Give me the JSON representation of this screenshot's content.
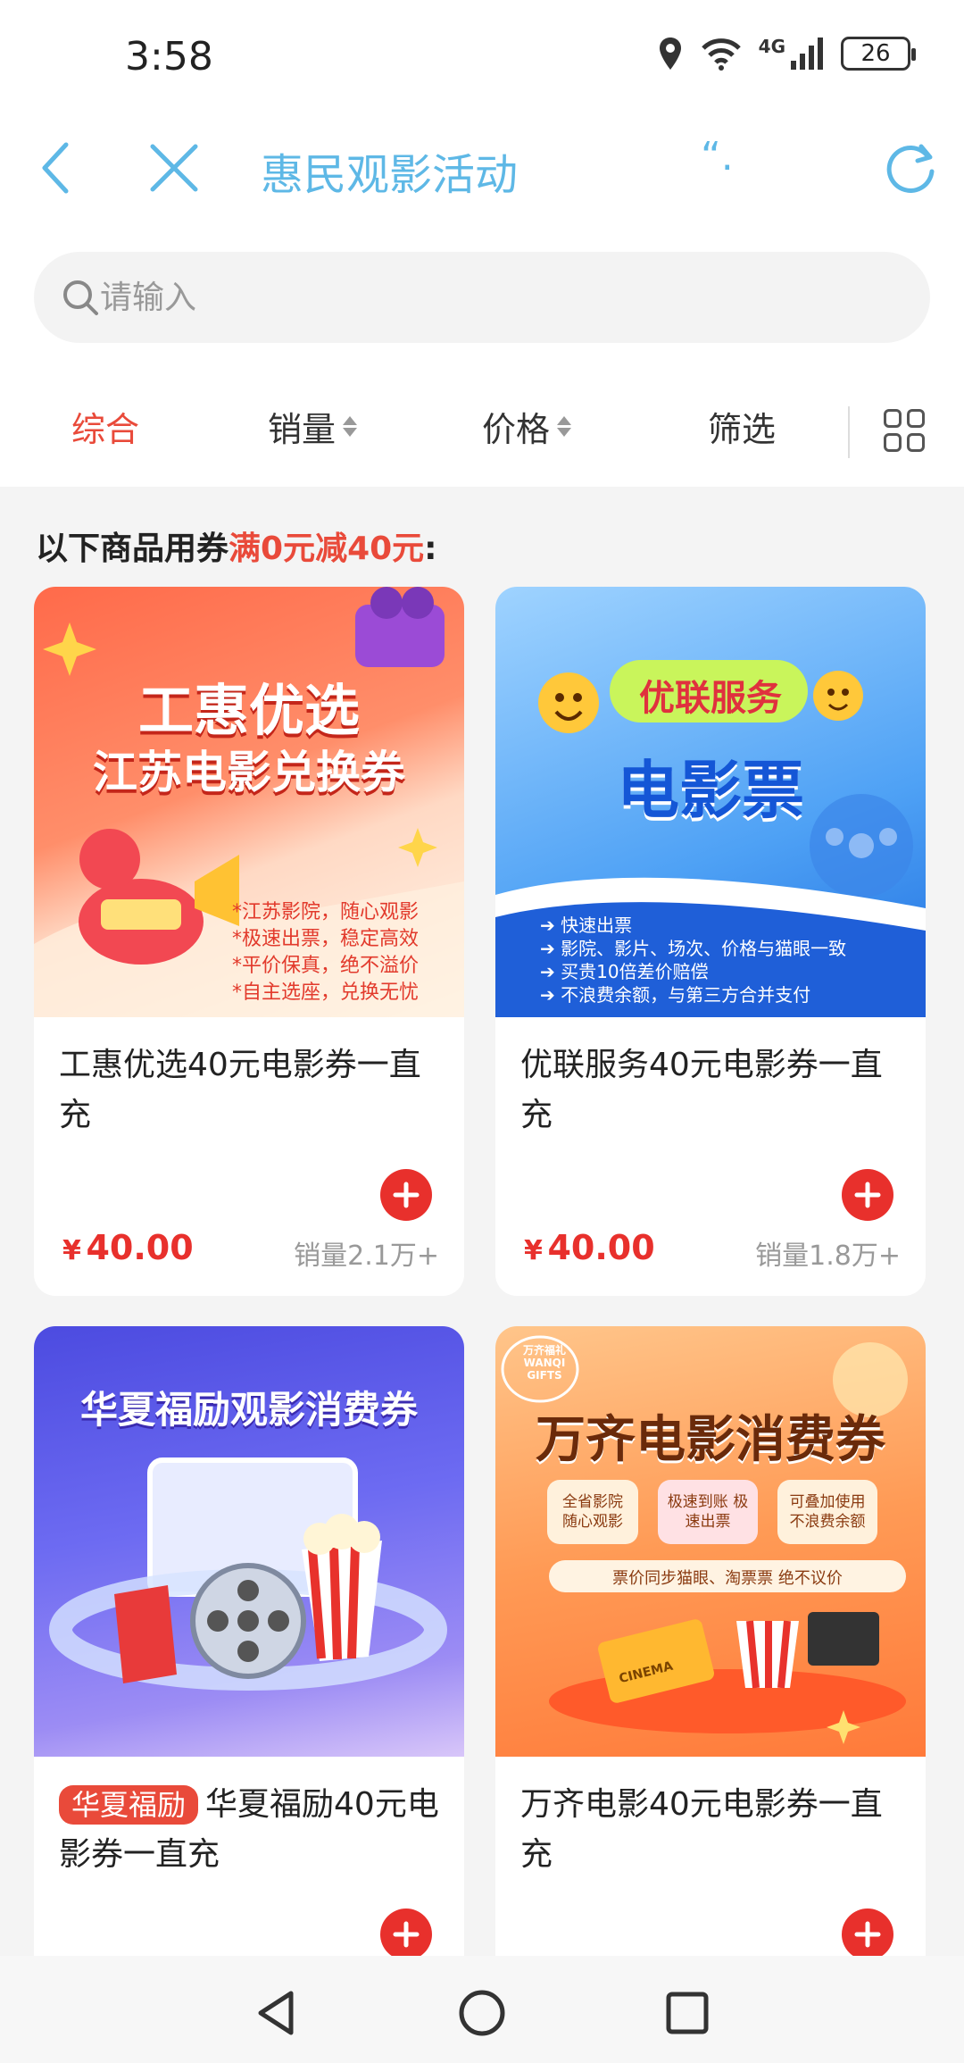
{
  "status_bar": {
    "time": "3:58",
    "network": "4G",
    "battery": "26"
  },
  "navbar": {
    "title": "惠民观影活动",
    "quote_mark": "“."
  },
  "search": {
    "placeholder": "请输入"
  },
  "sort": {
    "items": [
      {
        "label": "综合",
        "active": true
      },
      {
        "label": "销量",
        "active": false
      },
      {
        "label": "价格",
        "active": false
      },
      {
        "label": "筛选",
        "active": false
      }
    ]
  },
  "coupon_tip": {
    "prefix": "以下商品用券",
    "highlight": "满0元减40元",
    "suffix": ":"
  },
  "products": [
    {
      "title": "工惠优选40元电影券一直充",
      "badge": "",
      "currency": "¥",
      "price": "40.00",
      "sales": "销量2.1万+",
      "poster": {
        "line1": "工惠优选",
        "line2": "江苏电影兑换券",
        "bullets": [
          "*江苏影院，随心观影",
          "*极速出票，稳定高效",
          "*平价保真，绝不溢价",
          "*自主选座，兑换无忧"
        ]
      }
    },
    {
      "title": "优联服务40元电影券一直充",
      "badge": "",
      "currency": "¥",
      "price": "40.00",
      "sales": "销量1.8万+",
      "poster": {
        "line1": "优联服务",
        "line2": "电影票",
        "bullets": [
          "快速出票",
          "影院、影片、场次、价格与猫眼一致",
          "买贵10倍差价赔偿",
          "不浪费余额，与第三方合并支付"
        ]
      }
    },
    {
      "title": "华夏福励40元电影券一直充",
      "badge": "华夏福励",
      "currency": "",
      "price": "",
      "sales": "",
      "poster": {
        "line1": "华夏福励观影消费券",
        "line2": "",
        "bullets": []
      }
    },
    {
      "title": "万齐电影40元电影券一直充",
      "badge": "",
      "currency": "",
      "price": "",
      "sales": "",
      "poster": {
        "logo": "万齐福礼 WANQI GIFTS",
        "line1": "万齐电影消费券",
        "line2": "",
        "bullets": [
          "全省影院 随心观影",
          "极速到账 极速出票",
          "可叠加使用 不浪费余额",
          "票价同步猫眼、淘票票 绝不议价"
        ],
        "ticket_text": "CINEMA"
      }
    }
  ],
  "colors": {
    "accent_red": "#e94a3a",
    "nav_blue": "#5eb8e6"
  }
}
